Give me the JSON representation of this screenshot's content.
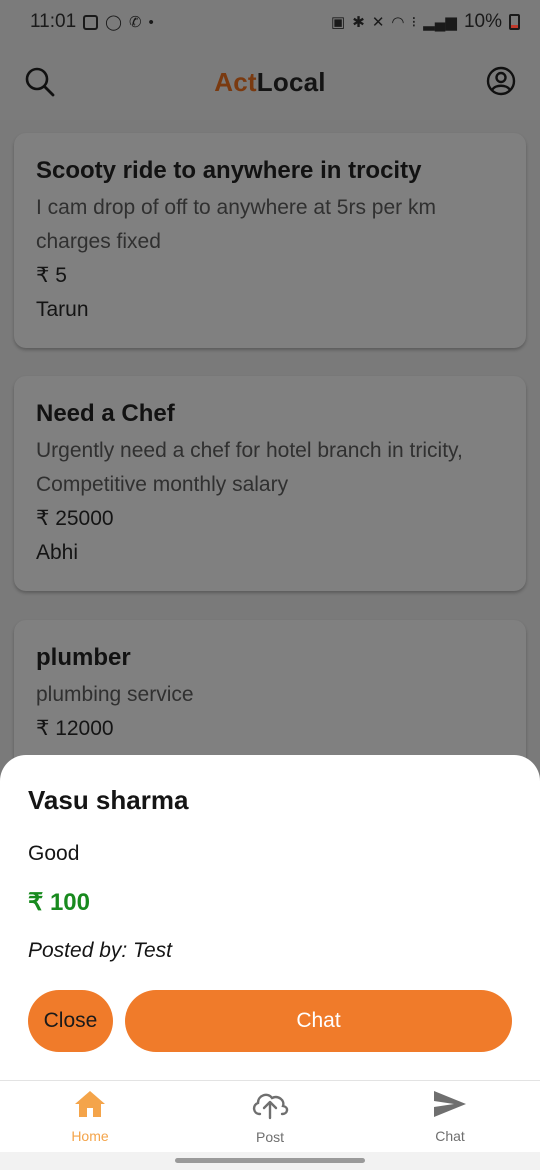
{
  "status_bar": {
    "time": "11:01",
    "dot": "•",
    "battery": "10%"
  },
  "app_bar": {
    "logo_part1": "Act",
    "logo_part2": "Local",
    "left_icon": "search-icon",
    "right_icon": "account-icon"
  },
  "listings": [
    {
      "title": "Scooty ride to anywhere in trocity",
      "description": "I cam drop of off to anywhere at 5rs per km charges fixed",
      "price": "₹ 5",
      "author": "Tarun"
    },
    {
      "title": "Need a Chef",
      "description": "Urgently need a chef for hotel branch in tricity, Competitive monthly salary",
      "price": "₹ 25000",
      "author": "Abhi"
    },
    {
      "title": "plumber",
      "description": "plumbing service",
      "price": "₹ 12000",
      "author": ""
    }
  ],
  "sheet": {
    "title": "Vasu sharma",
    "description": "Good",
    "price": "₹ 100",
    "poster": "Posted by: Test",
    "close_label": "Close",
    "chat_label": "Chat"
  },
  "bottom_nav": [
    {
      "label": "Home",
      "icon": "home-icon",
      "active": true
    },
    {
      "label": "Post",
      "icon": "upload-cloud-icon",
      "active": false
    },
    {
      "label": "Chat",
      "icon": "send-icon",
      "active": false
    }
  ],
  "colors": {
    "accent": "#f07b2a",
    "price_green": "#188a1e",
    "nav_active": "#f4a44a",
    "logo_brown": "#7a3a10"
  }
}
